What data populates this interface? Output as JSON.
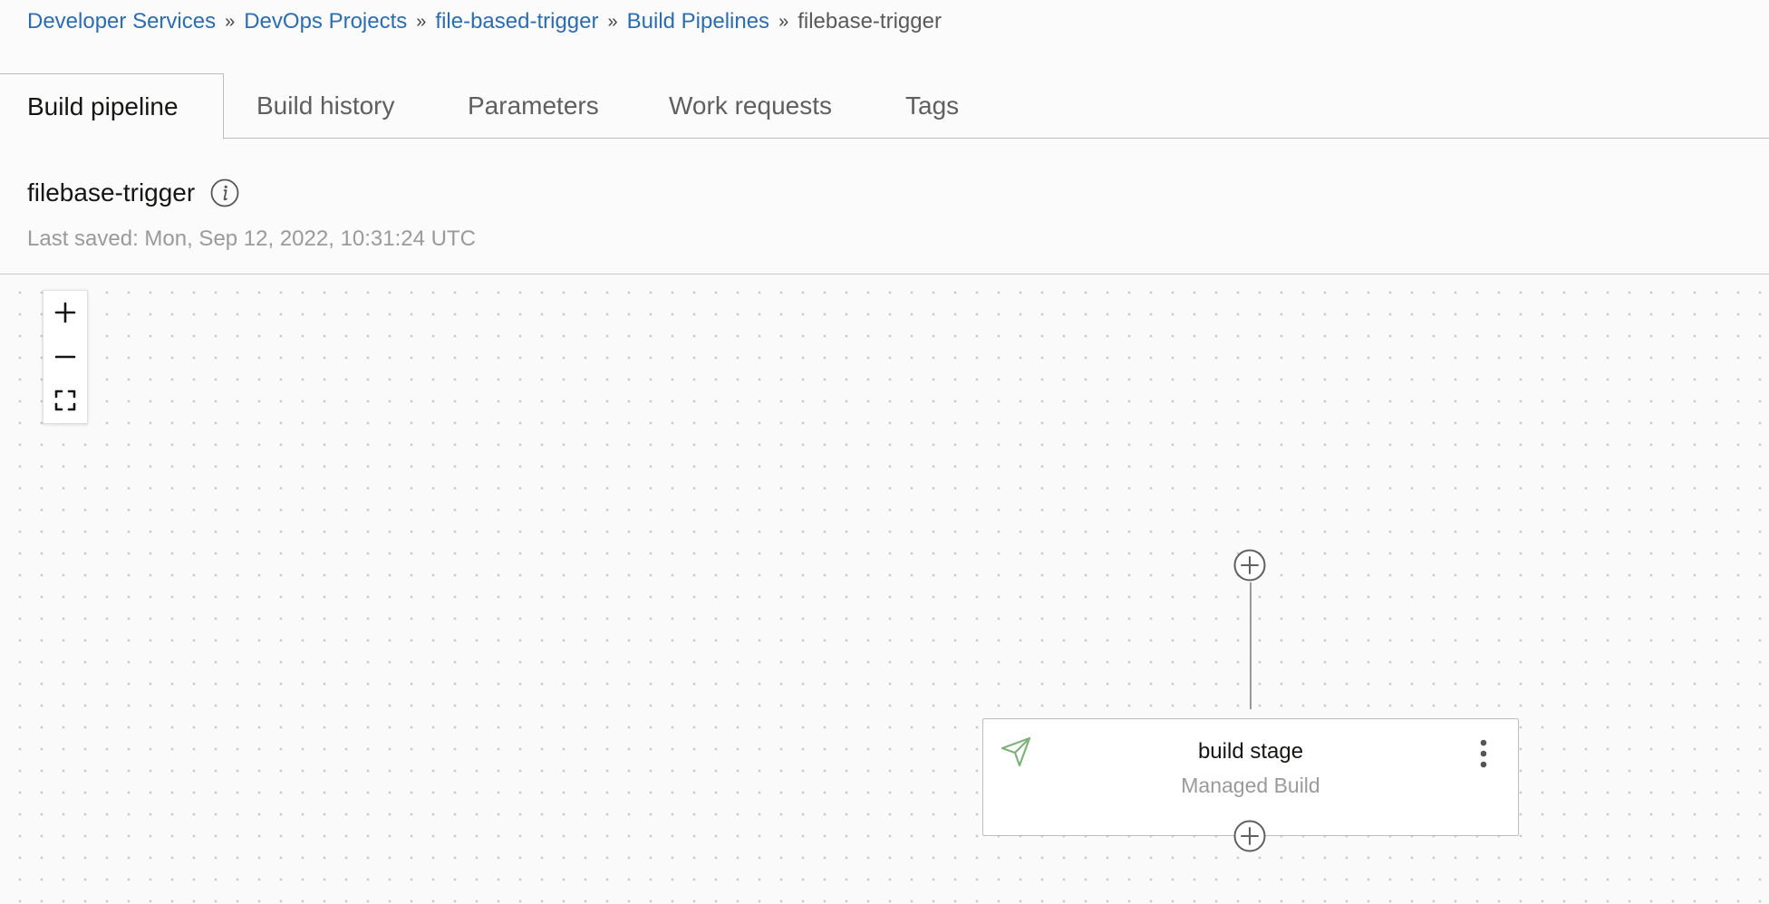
{
  "breadcrumb": {
    "items": [
      {
        "label": "Developer Services"
      },
      {
        "label": "DevOps Projects"
      },
      {
        "label": "file-based-trigger"
      },
      {
        "label": "Build Pipelines"
      }
    ],
    "current": "filebase-trigger",
    "separator": "»"
  },
  "tabs": [
    {
      "label": "Build pipeline",
      "active": true
    },
    {
      "label": "Build history"
    },
    {
      "label": "Parameters"
    },
    {
      "label": "Work requests"
    },
    {
      "label": "Tags"
    }
  ],
  "header": {
    "pipeline_name": "filebase-trigger",
    "last_saved": "Last saved: Mon, Sep 12, 2022, 10:31:24 UTC"
  },
  "zoom_controls": {
    "zoom_in_icon": "plus-icon",
    "zoom_out_icon": "minus-icon",
    "fit_icon": "fit-to-screen-icon"
  },
  "stage": {
    "title": "build stage",
    "subtitle": "Managed Build",
    "icon": "send-arrow-icon",
    "icon_color": "#7fb27b"
  },
  "colors": {
    "link": "#2b6db0",
    "muted_text": "#9a9a9a",
    "border": "#bdbdbd"
  }
}
